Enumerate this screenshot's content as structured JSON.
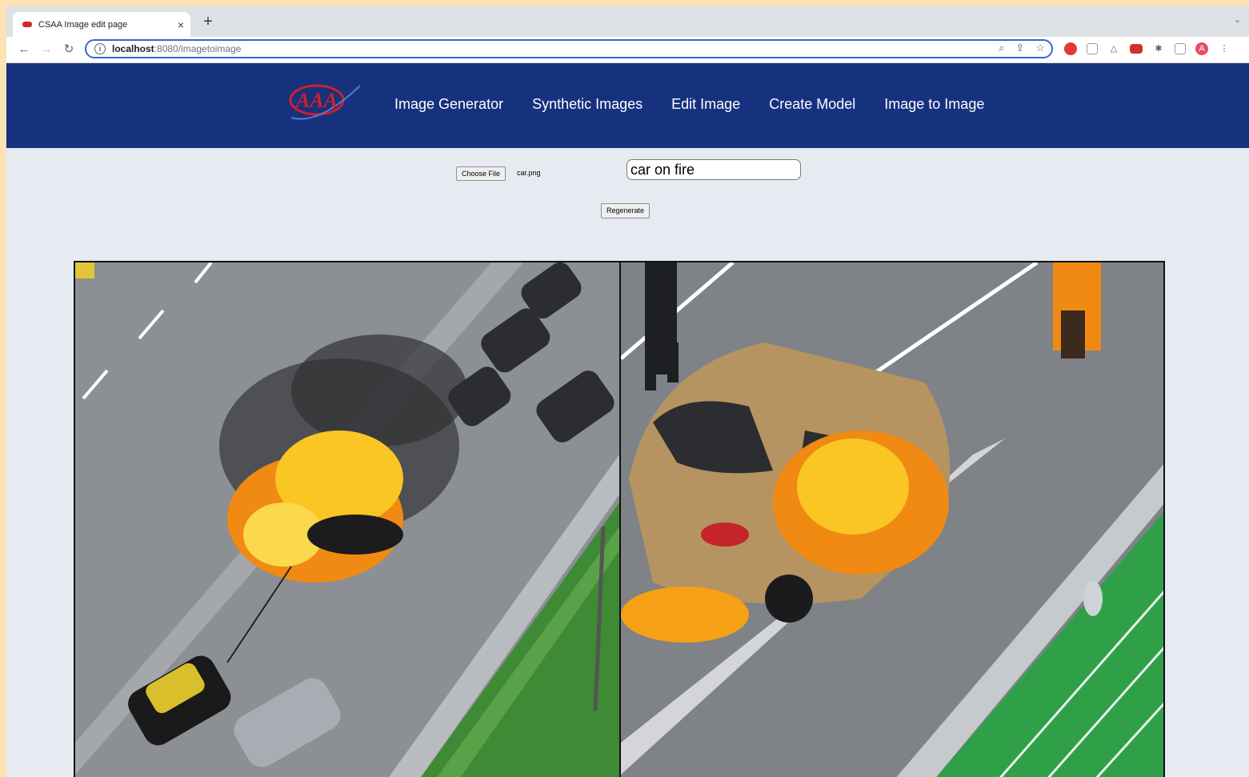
{
  "browser": {
    "tab_title": "CSAA Image edit page",
    "tab_close": "×",
    "new_tab": "+",
    "url_host": "localhost",
    "url_rest": ":8080/imagetoimage",
    "avatar_letter": "A"
  },
  "nav": {
    "items": [
      "Image Generator",
      "Synthetic Images",
      "Edit Image",
      "Create Model",
      "Image to Image"
    ]
  },
  "form": {
    "choose_file_label": "Choose File",
    "file_name": "car.png",
    "prompt_value": "car on fire",
    "regenerate_label": "Regenerate"
  },
  "colors": {
    "header_bg": "#16317e",
    "page_bg": "#e6ebf1",
    "accent_red": "#d6282c"
  }
}
